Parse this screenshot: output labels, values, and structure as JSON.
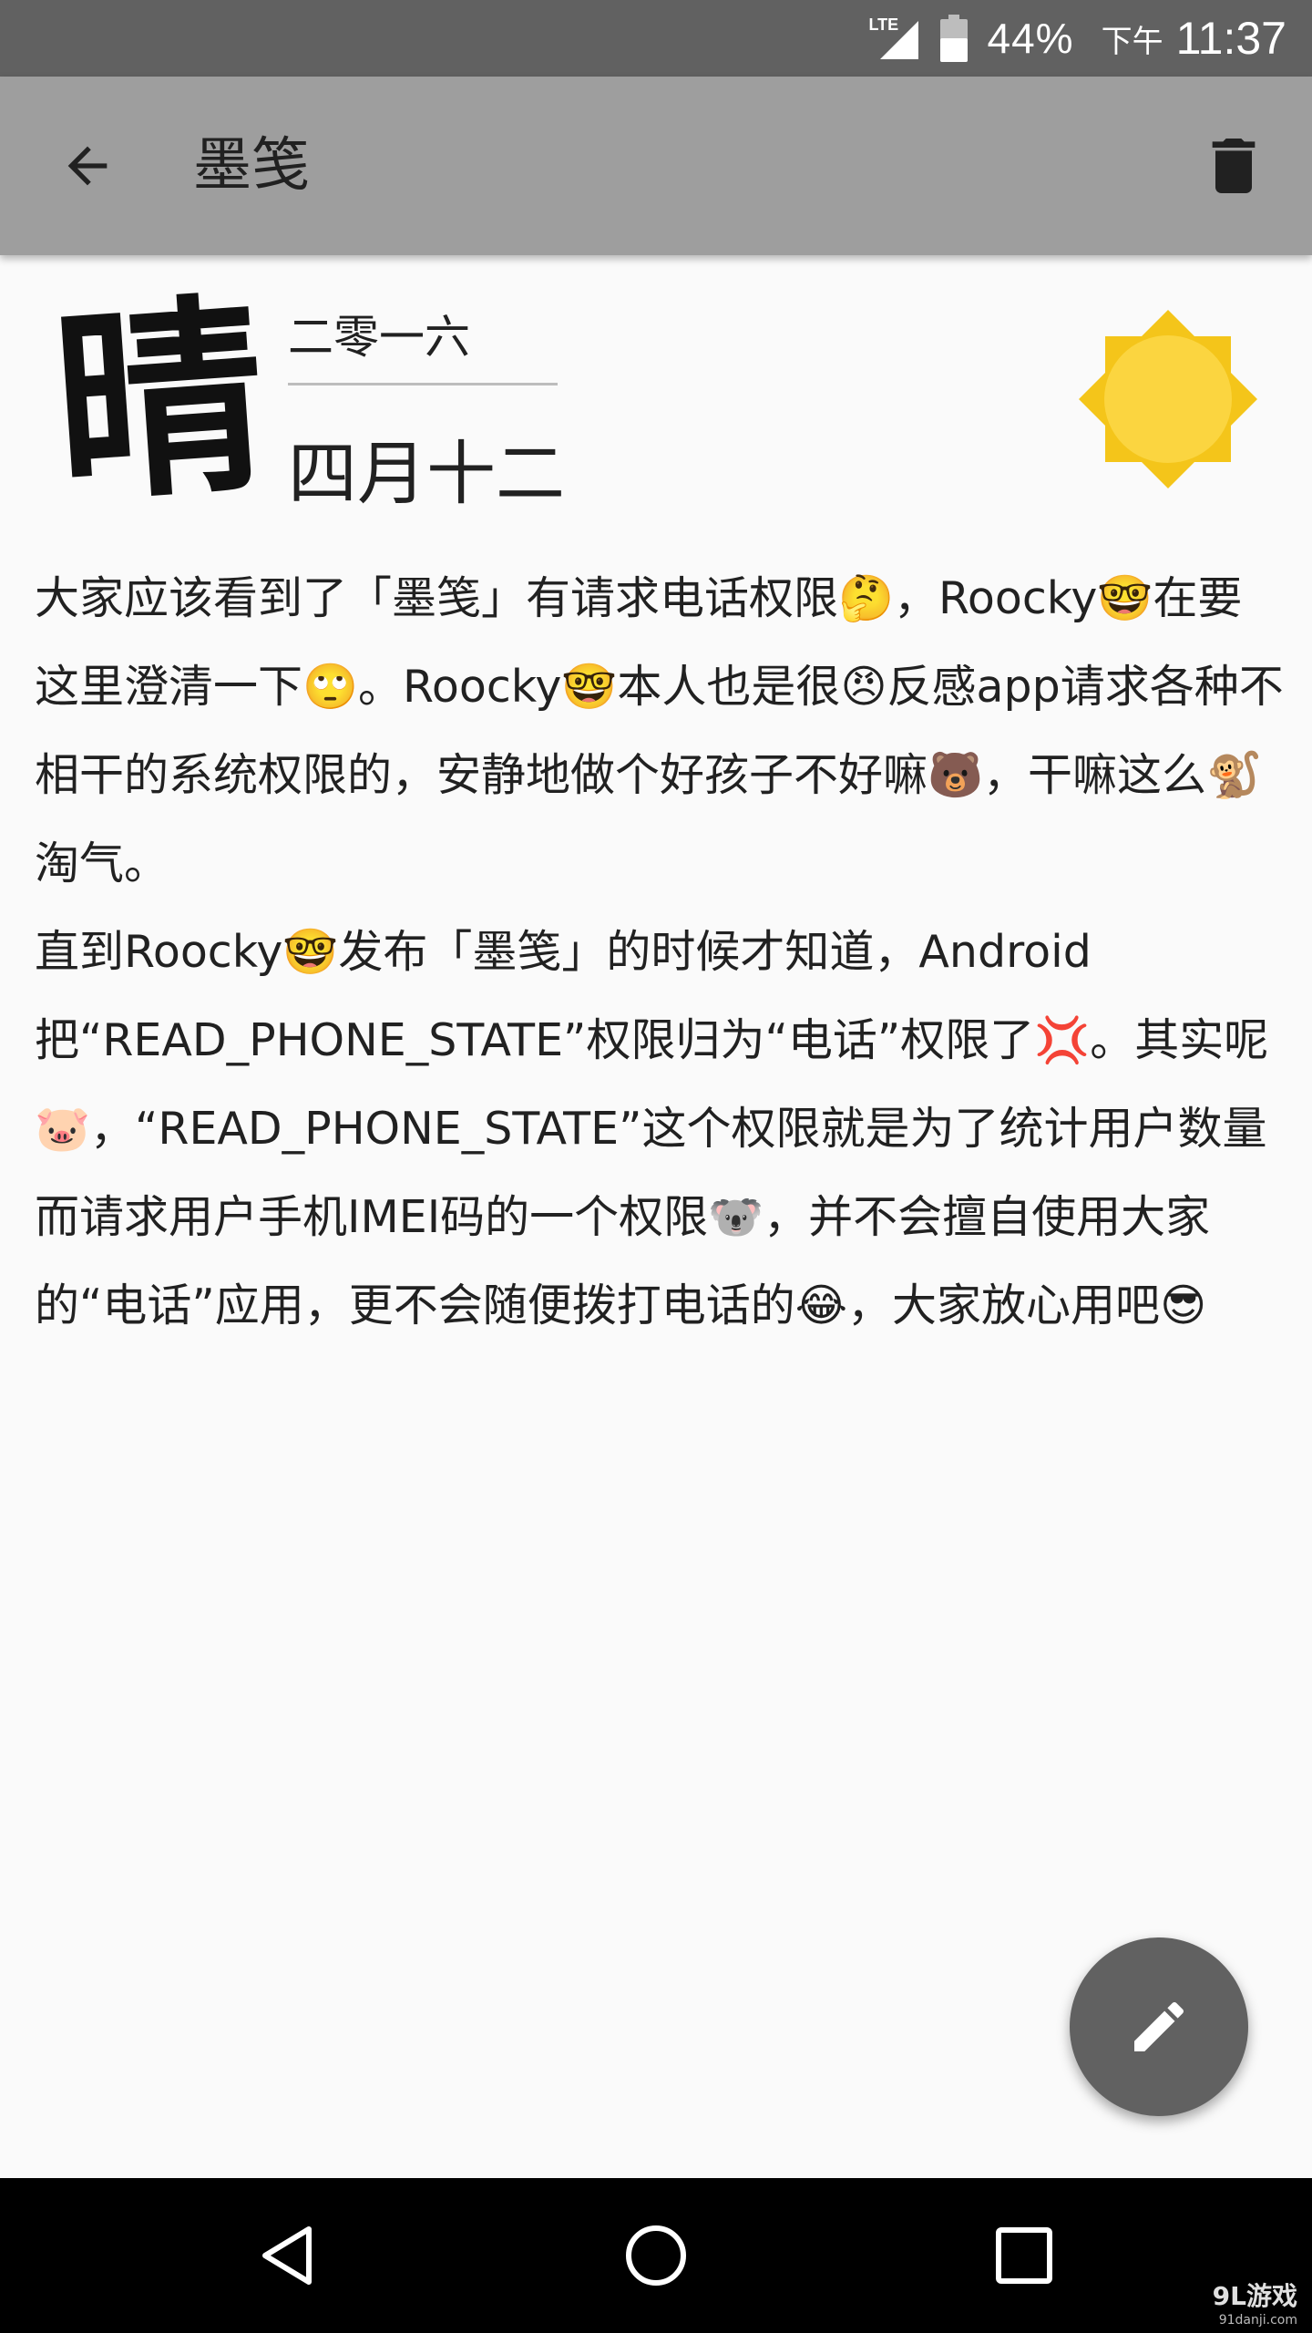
{
  "status_bar": {
    "network": "LTE",
    "battery": "44%",
    "ampm": "下午",
    "time": "11:37"
  },
  "app_bar": {
    "title": "墨笺",
    "back_icon": "arrow-back-icon",
    "delete_icon": "trash-icon"
  },
  "entry": {
    "weather_char": "晴",
    "year": "二零一六",
    "month_day": "四月十二",
    "weather_icon": "sun-icon"
  },
  "body": {
    "p1": [
      "大家应该看到了「墨笺」有请求电话权限",
      "🤔",
      "，Roocky",
      "🤓",
      "在要这里澄清一下",
      "🙄",
      "。Roocky",
      "🤓",
      "本人也是很",
      "😠",
      "反感app请求各种不相干的系统权限的，安静地做个好孩子不好嘛",
      "🐻",
      "，干嘛这么",
      "🐒",
      "淘气。"
    ],
    "p2": [
      "直到Roocky",
      "🤓",
      "发布「墨笺」的时候才知道，Android把“READ_PHONE_STATE”权限归为“电话”权限了",
      "💢",
      "。其实呢",
      "🐷",
      "，“READ_PHONE_STATE”这个权限就是为了统计用户数量而请求用户手机IMEI码的一个权限",
      "🐨",
      "，并不会擅自使用大家的“电话”应用，更不会随便拨打电话的",
      "😂",
      "，大家放心用吧",
      "😎"
    ]
  },
  "fab": {
    "icon": "pencil-icon"
  },
  "nav_bar": {
    "back_icon": "nav-back-icon",
    "home_icon": "nav-home-icon",
    "recents_icon": "nav-recents-icon"
  },
  "watermark": {
    "main": "9L游戏",
    "sub": "91danji.com"
  },
  "colors": {
    "status_bar": "#616161",
    "app_bar": "#9e9e9e",
    "fab": "#616161",
    "sun": "#fbd540",
    "sun_ray": "#f4c51a",
    "nav_bar": "#000000"
  }
}
